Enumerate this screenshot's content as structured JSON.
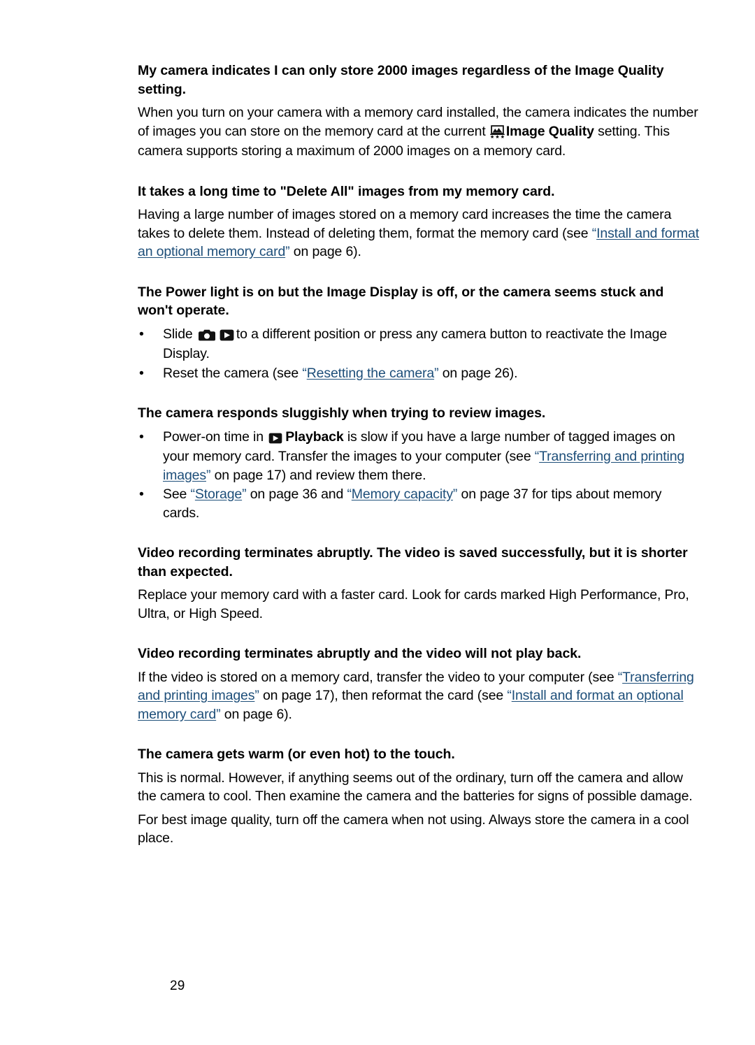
{
  "document": {
    "page_number": "29",
    "link_color": "#1d4e79",
    "text_color": "#000000",
    "background_color": "#ffffff"
  },
  "sections": [
    {
      "heading": "My camera indicates I can only store 2000 images regardless of the Image Quality setting.",
      "paragraph_1_a": "When you turn on your camera with a memory card installed, the camera indicates the number of images you can store on the memory card at the current",
      "icon": "image-quality-icon",
      "paragraph_1_b": "Image Quality",
      "paragraph_1_c": "setting. This camera supports storing a maximum of 2000 images on a memory card."
    },
    {
      "heading": "It takes a long time to \"Delete All\" images from my memory card.",
      "paragraph_a": "Having a large number of images stored on a memory card increases the time the camera takes to delete them. Instead of deleting them, format the memory card (see",
      "link_text": "Install and format an optional memory card",
      "paragraph_b": "on page 6)."
    },
    {
      "heading": "The Power light is on but the Image Display is off, or the camera seems stuck and won't operate.",
      "bullets": [
        {
          "text_a": "Slide",
          "icon_1": "camera-mode-icon",
          "icon_2": "playback-mode-icon",
          "text_b": "to a different position or press any camera button to reactivate the Image Display."
        },
        {
          "text_a": "Reset the camera (see",
          "link_text": "Resetting the camera",
          "text_b": "on page 26)."
        }
      ]
    },
    {
      "heading": "The camera responds sluggishly when trying to review images.",
      "bullets": [
        {
          "text_a": "Power-on time in",
          "icon": "playback-mode-icon",
          "bold_text": "Playback",
          "text_b": "is slow if you have a large number of tagged images on your memory card. Transfer the images to your computer (see",
          "link_text": "Transferring and printing images",
          "text_c": "on page 17) and review them there."
        },
        {
          "text_a": "See",
          "link_1": "Storage",
          "text_b": "on page 36 and",
          "link_2": "Memory capacity",
          "text_c": "on page 37 for tips about memory cards."
        }
      ]
    },
    {
      "heading": "Video recording terminates abruptly. The video is saved successfully, but it is shorter than expected.",
      "paragraph": "Replace your memory card with a faster card. Look for cards marked High Performance, Pro, Ultra, or High Speed."
    },
    {
      "heading": "Video recording terminates abruptly and the video will not play back.",
      "paragraph_a": "If the video is stored on a memory card, transfer the video to your computer (see",
      "link_1": "Transferring and printing images",
      "paragraph_b": "on page 17), then reformat the card (see",
      "link_2": "Install and format an optional memory card",
      "paragraph_c": "on page 6)."
    },
    {
      "heading": "The camera gets warm (or even hot) to the touch.",
      "paragraph_1": "This is normal. However, if anything seems out of the ordinary, turn off the camera and allow the camera to cool. Then examine the camera and the batteries for signs of possible damage.",
      "paragraph_2": "For best image quality, turn off the camera when not using. Always store the camera in a cool place."
    }
  ],
  "punctuation": {
    "open_quote": "“",
    "close_quote": "”"
  }
}
